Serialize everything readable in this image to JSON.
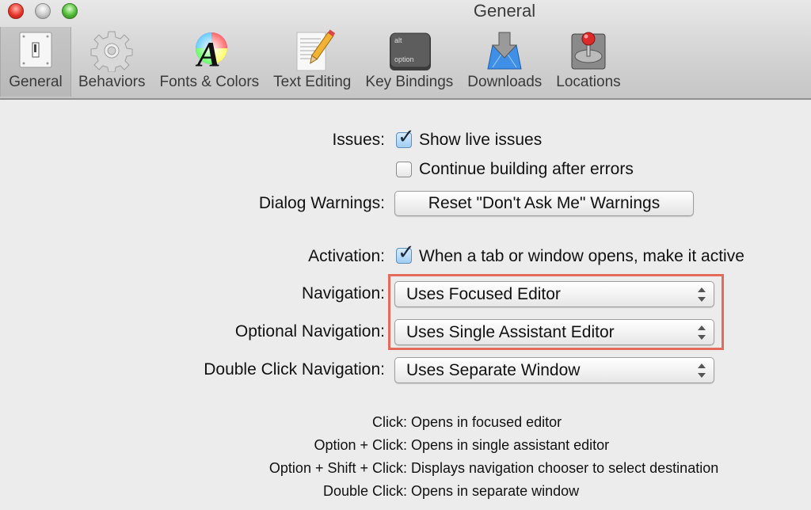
{
  "window": {
    "title": "General"
  },
  "toolbar": {
    "items": [
      {
        "label": "General",
        "icon": "light-switch-icon",
        "selected": true
      },
      {
        "label": "Behaviors",
        "icon": "gear-icon"
      },
      {
        "label": "Fonts & Colors",
        "icon": "font-color-wheel-icon"
      },
      {
        "label": "Text Editing",
        "icon": "document-pencil-icon"
      },
      {
        "label": "Key Bindings",
        "icon": "option-key-icon"
      },
      {
        "label": "Downloads",
        "icon": "download-arrow-icon"
      },
      {
        "label": "Locations",
        "icon": "hard-drive-joystick-icon"
      }
    ]
  },
  "settings": {
    "issues_label": "Issues:",
    "show_live_issues": {
      "label": "Show live issues",
      "checked": true
    },
    "continue_building": {
      "label": "Continue building after errors",
      "checked": false
    },
    "dialog_warnings_label": "Dialog Warnings:",
    "reset_button": "Reset \"Don't Ask Me\" Warnings",
    "activation_label": "Activation:",
    "activation": {
      "label": "When a tab or window opens, make it active",
      "checked": true
    },
    "navigation_label": "Navigation:",
    "navigation_value": "Uses Focused Editor",
    "optional_navigation_label": "Optional Navigation:",
    "optional_navigation_value": "Uses Single Assistant Editor",
    "double_click_navigation_label": "Double Click Navigation:",
    "double_click_navigation_value": "Uses Separate Window"
  },
  "help": [
    {
      "key": "Click:",
      "desc": "Opens in focused editor"
    },
    {
      "key": "Option + Click:",
      "desc": "Opens in single assistant editor"
    },
    {
      "key": "Option + Shift + Click:",
      "desc": "Displays navigation chooser to select destination"
    },
    {
      "key": "Double Click:",
      "desc": "Opens in separate window"
    }
  ],
  "colors": {
    "highlight": "#e46b5c",
    "checkbox_checked": "#9fcdf3"
  }
}
